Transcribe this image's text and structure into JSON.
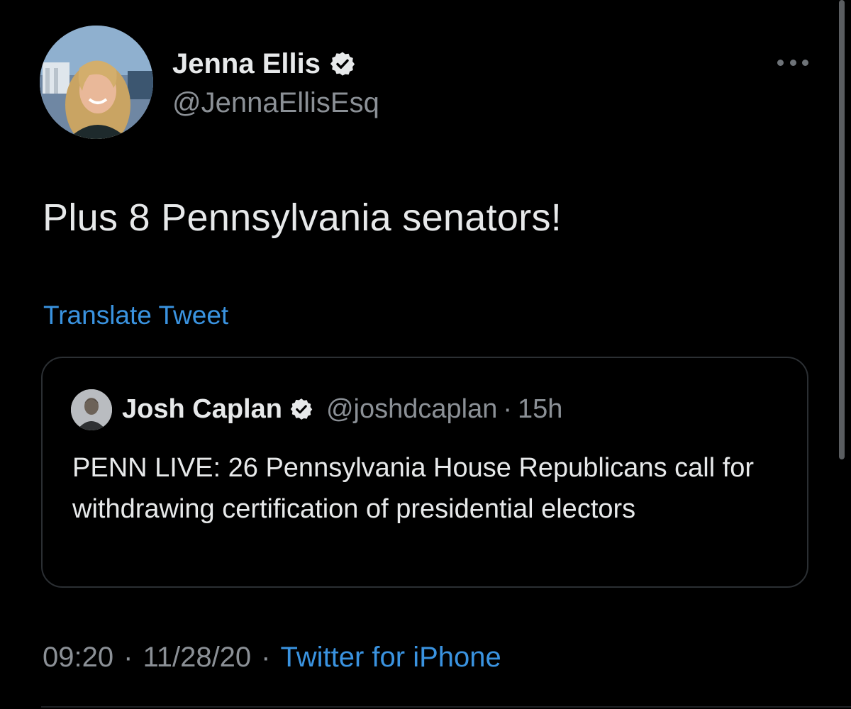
{
  "tweet": {
    "author_name": "Jenna Ellis",
    "author_handle": "@JennaEllisEsq",
    "text": "Plus 8 Pennsylvania senators!",
    "translate_label": "Translate Tweet",
    "quoted": {
      "author_name": "Josh Caplan",
      "author_handle": "@joshdcaplan",
      "separator": "·",
      "time_ago": "15h",
      "text": "PENN LIVE: 26 Pennsylvania House Republicans call for withdrawing certification of presidential electors"
    },
    "time": "09:20",
    "date": "11/28/20",
    "source": "Twitter for iPhone",
    "separator": "·"
  },
  "icons": {
    "more": "more-options-icon",
    "verified": "verified-badge-icon"
  },
  "colors": {
    "background": "#000000",
    "primary_text": "#e7e9ea",
    "secondary_text": "#8b9096",
    "link": "#3a93e0",
    "card_border": "#2b2f33"
  }
}
